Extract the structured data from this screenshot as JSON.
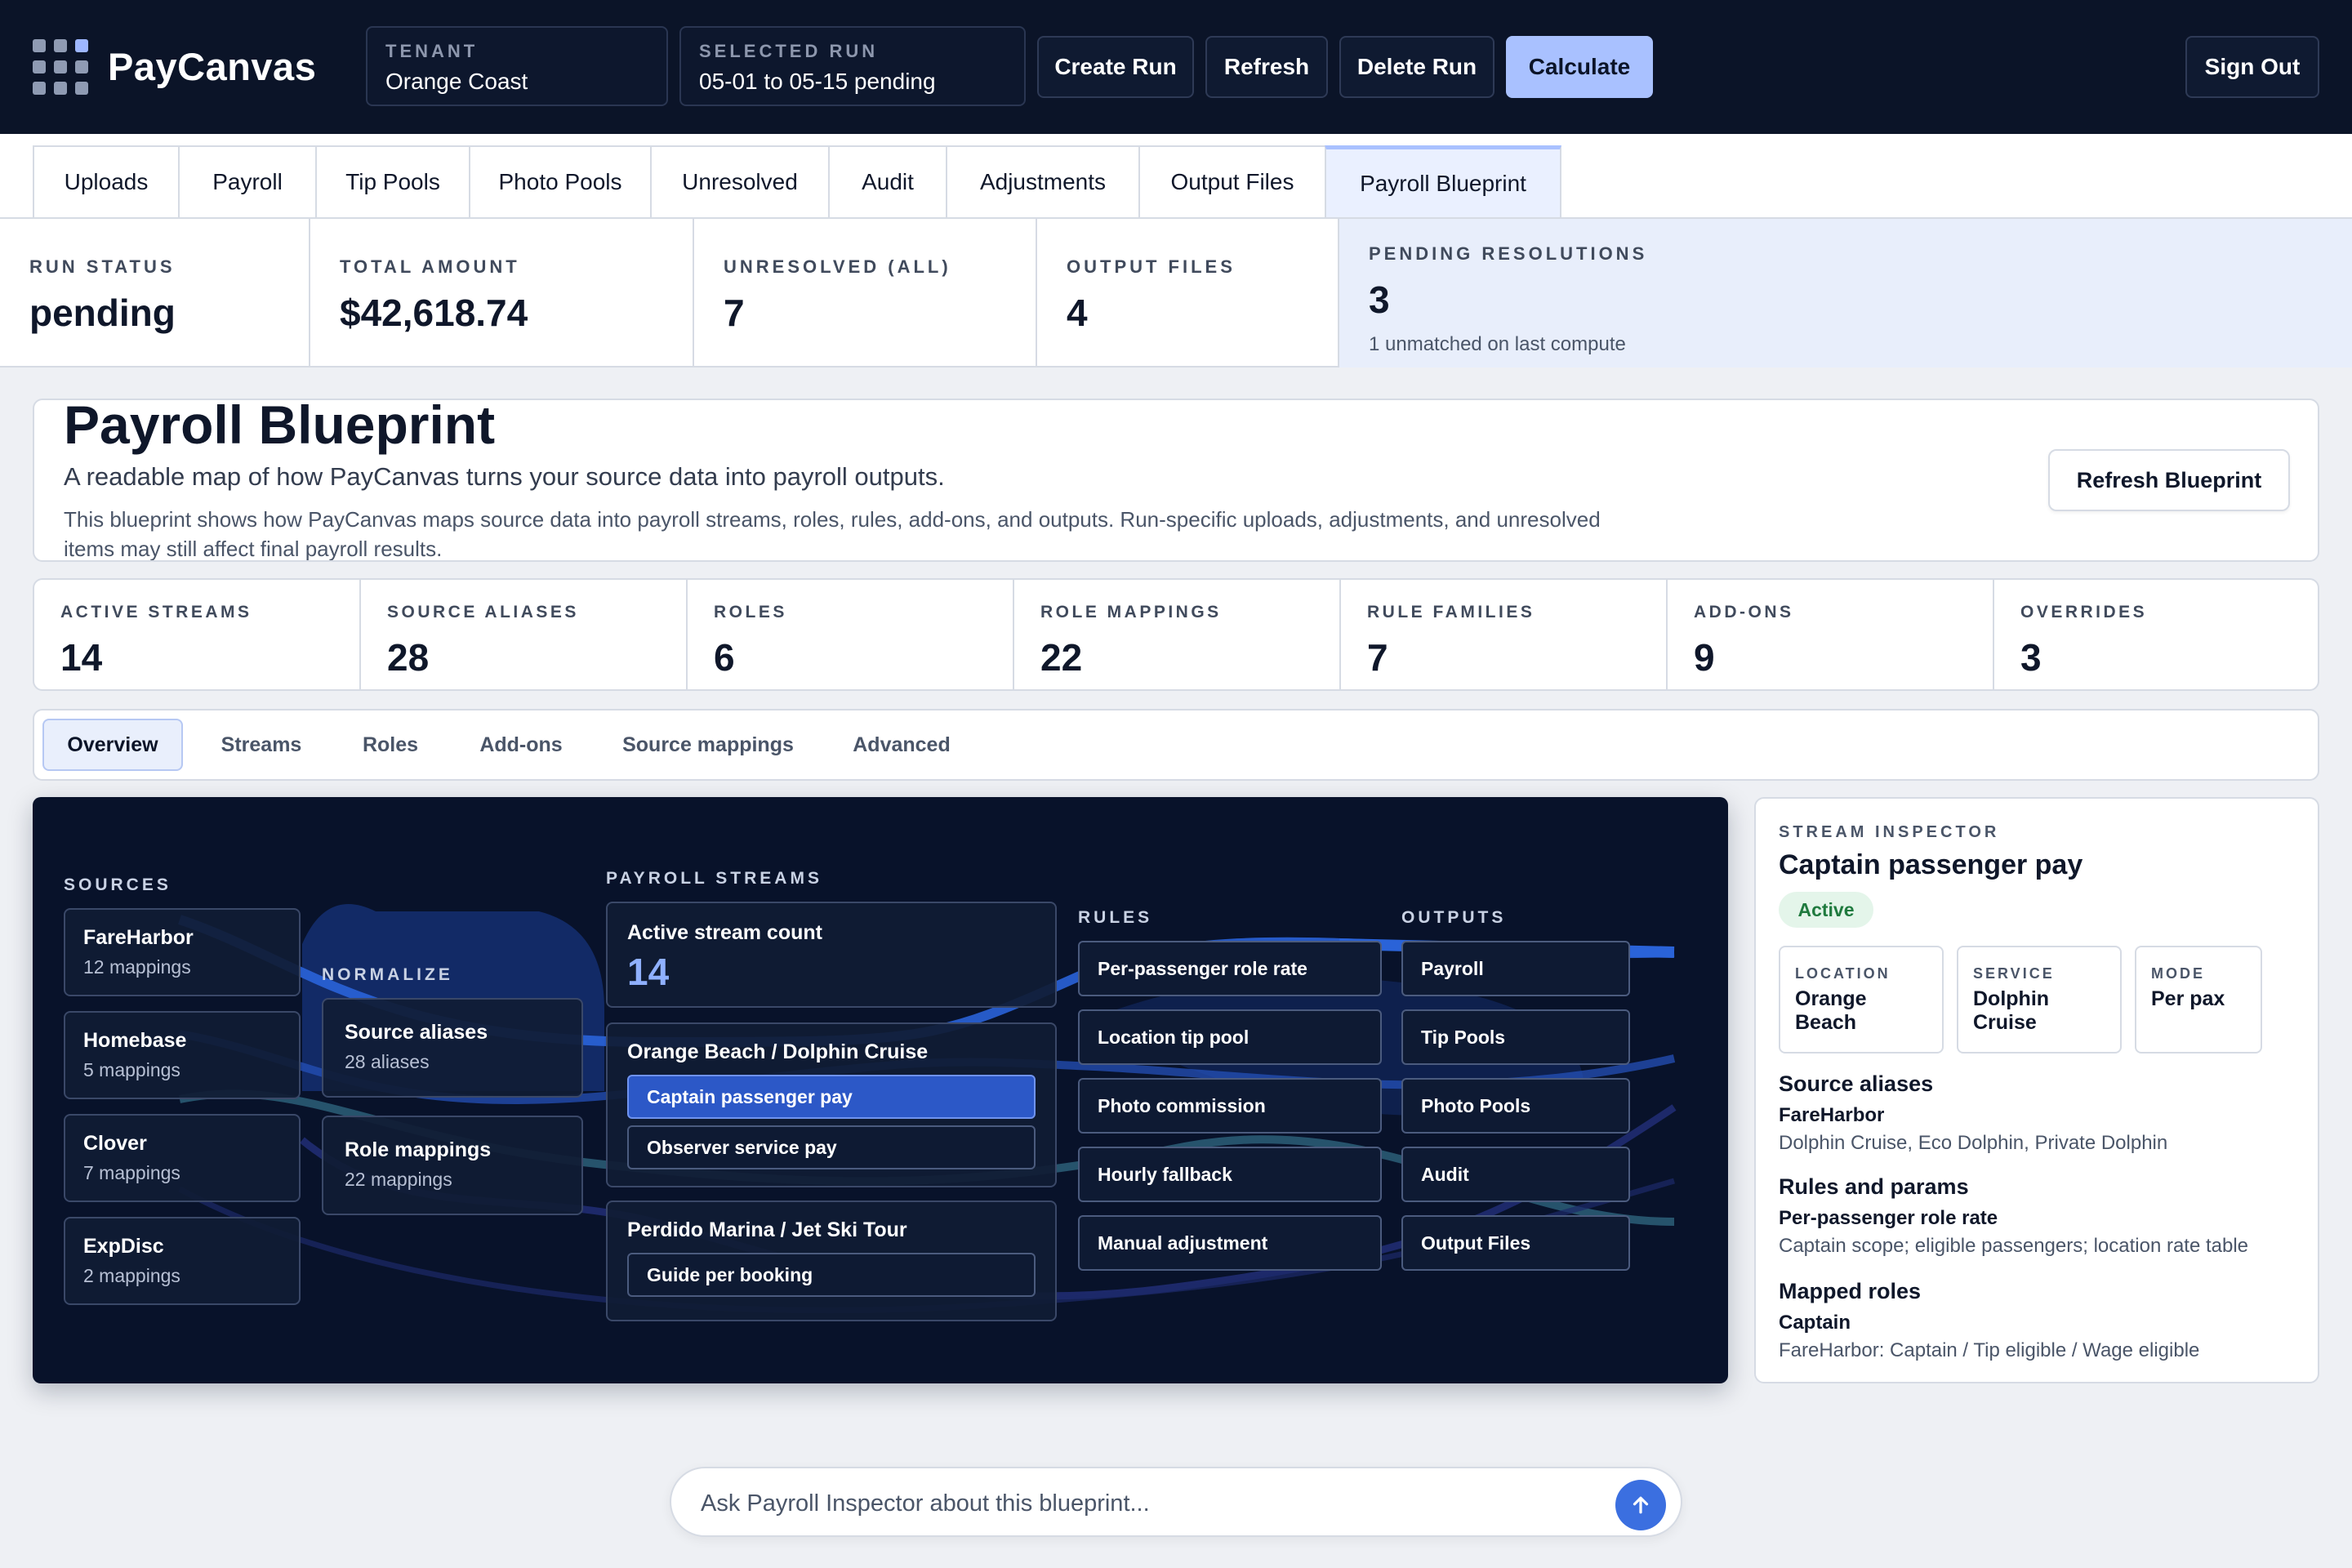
{
  "app": {
    "name": "PayCanvas"
  },
  "header": {
    "tenant_label": "TENANT",
    "tenant_value": "Orange Coast",
    "run_label": "SELECTED RUN",
    "run_value": "05-01 to 05-15 pending",
    "buttons": {
      "create": "Create Run",
      "refresh": "Refresh",
      "delete": "Delete Run",
      "calculate": "Calculate",
      "signout": "Sign Out"
    }
  },
  "tabs": [
    "Uploads",
    "Payroll",
    "Tip Pools",
    "Photo Pools",
    "Unresolved",
    "Audit",
    "Adjustments",
    "Output Files",
    "Payroll Blueprint"
  ],
  "active_tab": "Payroll Blueprint",
  "stats": [
    {
      "label": "RUN STATUS",
      "value": "pending"
    },
    {
      "label": "TOTAL AMOUNT",
      "value": "$42,618.74"
    },
    {
      "label": "UNRESOLVED (ALL)",
      "value": "7"
    },
    {
      "label": "OUTPUT FILES",
      "value": "4"
    },
    {
      "label": "PENDING RESOLUTIONS",
      "value": "3",
      "sub": "1 unmatched on last compute"
    }
  ],
  "blueprint": {
    "title": "Payroll Blueprint",
    "subtitle": "A readable map of how PayCanvas turns your source data into payroll outputs.",
    "description": "This blueprint shows how PayCanvas maps source data into payroll streams, roles, rules, add-ons, and outputs. Run-specific uploads, adjustments, and unresolved items may still affect final payroll results.",
    "refresh_label": "Refresh Blueprint"
  },
  "metrics": [
    {
      "label": "ACTIVE STREAMS",
      "value": "14"
    },
    {
      "label": "SOURCE ALIASES",
      "value": "28"
    },
    {
      "label": "ROLES",
      "value": "6"
    },
    {
      "label": "ROLE MAPPINGS",
      "value": "22"
    },
    {
      "label": "RULE FAMILIES",
      "value": "7"
    },
    {
      "label": "ADD-ONS",
      "value": "9"
    },
    {
      "label": "OVERRIDES",
      "value": "3"
    }
  ],
  "subtabs": [
    "Overview",
    "Streams",
    "Roles",
    "Add-ons",
    "Source mappings",
    "Advanced"
  ],
  "active_subtab": "Overview",
  "diagram": {
    "headers": {
      "sources": "SOURCES",
      "normalize": "NORMALIZE",
      "streams": "PAYROLL STREAMS",
      "rules": "RULES",
      "outputs": "OUTPUTS"
    },
    "sources": [
      {
        "name": "FareHarbor",
        "detail": "12 mappings"
      },
      {
        "name": "Homebase",
        "detail": "5 mappings"
      },
      {
        "name": "Clover",
        "detail": "7 mappings"
      },
      {
        "name": "ExpDisc",
        "detail": "2 mappings"
      }
    ],
    "normalize": [
      {
        "name": "Source aliases",
        "detail": "28 aliases"
      },
      {
        "name": "Role mappings",
        "detail": "22 mappings"
      }
    ],
    "stream_count_label": "Active stream count",
    "stream_count": "14",
    "groups": [
      {
        "name": "Orange Beach / Dolphin Cruise",
        "items": [
          "Captain passenger pay",
          "Observer service pay"
        ]
      },
      {
        "name": "Perdido Marina / Jet Ski Tour",
        "items": [
          "Guide per booking"
        ]
      }
    ],
    "rules": [
      "Per-passenger role rate",
      "Location tip pool",
      "Photo commission",
      "Hourly fallback",
      "Manual adjustment"
    ],
    "outputs": [
      "Payroll",
      "Tip Pools",
      "Photo Pools",
      "Audit",
      "Output Files"
    ]
  },
  "inspector": {
    "label": "STREAM INSPECTOR",
    "title": "Captain passenger pay",
    "status": "Active",
    "cards": [
      {
        "key": "LOCATION",
        "value": "Orange Beach"
      },
      {
        "key": "SERVICE",
        "value": "Dolphin Cruise"
      },
      {
        "key": "MODE",
        "value": "Per pax"
      }
    ],
    "aliases_heading": "Source aliases",
    "aliases_source": "FareHarbor",
    "aliases_values": "Dolphin Cruise, Eco Dolphin, Private Dolphin",
    "rules_heading": "Rules and params",
    "rule_name": "Per-passenger role rate",
    "rule_params": "Captain scope; eligible passengers; location rate table",
    "roles_heading": "Mapped roles",
    "role_name": "Captain",
    "role_detail": "FareHarbor: Captain / Tip eligible / Wage eligible"
  },
  "ask": {
    "placeholder": "Ask Payroll Inspector about this blueprint..."
  },
  "colors": {
    "topbar": "#0b1428",
    "accent": "#a9c1ff",
    "diagram_bg": "#08122a",
    "selected_stream": "#2c58c7",
    "active_badge": "#1f7a3e"
  }
}
